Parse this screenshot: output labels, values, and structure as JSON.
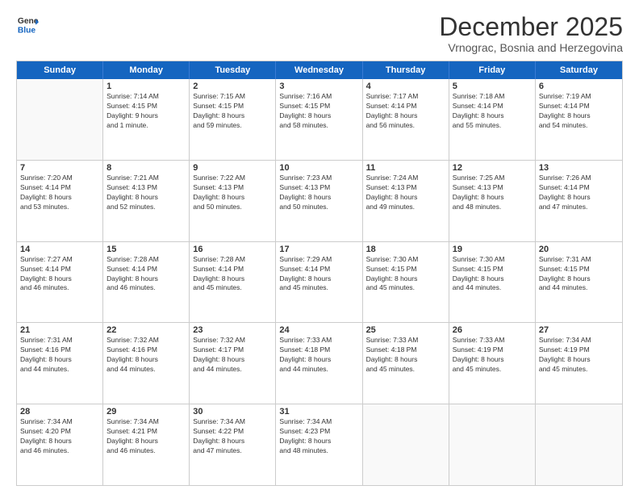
{
  "logo": {
    "line1": "General",
    "line2": "Blue"
  },
  "title": "December 2025",
  "subtitle": "Vrnograc, Bosnia and Herzegovina",
  "days": [
    "Sunday",
    "Monday",
    "Tuesday",
    "Wednesday",
    "Thursday",
    "Friday",
    "Saturday"
  ],
  "weeks": [
    [
      {
        "day": "",
        "text": ""
      },
      {
        "day": "1",
        "text": "Sunrise: 7:14 AM\nSunset: 4:15 PM\nDaylight: 9 hours\nand 1 minute."
      },
      {
        "day": "2",
        "text": "Sunrise: 7:15 AM\nSunset: 4:15 PM\nDaylight: 8 hours\nand 59 minutes."
      },
      {
        "day": "3",
        "text": "Sunrise: 7:16 AM\nSunset: 4:15 PM\nDaylight: 8 hours\nand 58 minutes."
      },
      {
        "day": "4",
        "text": "Sunrise: 7:17 AM\nSunset: 4:14 PM\nDaylight: 8 hours\nand 56 minutes."
      },
      {
        "day": "5",
        "text": "Sunrise: 7:18 AM\nSunset: 4:14 PM\nDaylight: 8 hours\nand 55 minutes."
      },
      {
        "day": "6",
        "text": "Sunrise: 7:19 AM\nSunset: 4:14 PM\nDaylight: 8 hours\nand 54 minutes."
      }
    ],
    [
      {
        "day": "7",
        "text": "Sunrise: 7:20 AM\nSunset: 4:14 PM\nDaylight: 8 hours\nand 53 minutes."
      },
      {
        "day": "8",
        "text": "Sunrise: 7:21 AM\nSunset: 4:13 PM\nDaylight: 8 hours\nand 52 minutes."
      },
      {
        "day": "9",
        "text": "Sunrise: 7:22 AM\nSunset: 4:13 PM\nDaylight: 8 hours\nand 50 minutes."
      },
      {
        "day": "10",
        "text": "Sunrise: 7:23 AM\nSunset: 4:13 PM\nDaylight: 8 hours\nand 50 minutes."
      },
      {
        "day": "11",
        "text": "Sunrise: 7:24 AM\nSunset: 4:13 PM\nDaylight: 8 hours\nand 49 minutes."
      },
      {
        "day": "12",
        "text": "Sunrise: 7:25 AM\nSunset: 4:13 PM\nDaylight: 8 hours\nand 48 minutes."
      },
      {
        "day": "13",
        "text": "Sunrise: 7:26 AM\nSunset: 4:14 PM\nDaylight: 8 hours\nand 47 minutes."
      }
    ],
    [
      {
        "day": "14",
        "text": "Sunrise: 7:27 AM\nSunset: 4:14 PM\nDaylight: 8 hours\nand 46 minutes."
      },
      {
        "day": "15",
        "text": "Sunrise: 7:28 AM\nSunset: 4:14 PM\nDaylight: 8 hours\nand 46 minutes."
      },
      {
        "day": "16",
        "text": "Sunrise: 7:28 AM\nSunset: 4:14 PM\nDaylight: 8 hours\nand 45 minutes."
      },
      {
        "day": "17",
        "text": "Sunrise: 7:29 AM\nSunset: 4:14 PM\nDaylight: 8 hours\nand 45 minutes."
      },
      {
        "day": "18",
        "text": "Sunrise: 7:30 AM\nSunset: 4:15 PM\nDaylight: 8 hours\nand 45 minutes."
      },
      {
        "day": "19",
        "text": "Sunrise: 7:30 AM\nSunset: 4:15 PM\nDaylight: 8 hours\nand 44 minutes."
      },
      {
        "day": "20",
        "text": "Sunrise: 7:31 AM\nSunset: 4:15 PM\nDaylight: 8 hours\nand 44 minutes."
      }
    ],
    [
      {
        "day": "21",
        "text": "Sunrise: 7:31 AM\nSunset: 4:16 PM\nDaylight: 8 hours\nand 44 minutes."
      },
      {
        "day": "22",
        "text": "Sunrise: 7:32 AM\nSunset: 4:16 PM\nDaylight: 8 hours\nand 44 minutes."
      },
      {
        "day": "23",
        "text": "Sunrise: 7:32 AM\nSunset: 4:17 PM\nDaylight: 8 hours\nand 44 minutes."
      },
      {
        "day": "24",
        "text": "Sunrise: 7:33 AM\nSunset: 4:18 PM\nDaylight: 8 hours\nand 44 minutes."
      },
      {
        "day": "25",
        "text": "Sunrise: 7:33 AM\nSunset: 4:18 PM\nDaylight: 8 hours\nand 45 minutes."
      },
      {
        "day": "26",
        "text": "Sunrise: 7:33 AM\nSunset: 4:19 PM\nDaylight: 8 hours\nand 45 minutes."
      },
      {
        "day": "27",
        "text": "Sunrise: 7:34 AM\nSunset: 4:19 PM\nDaylight: 8 hours\nand 45 minutes."
      }
    ],
    [
      {
        "day": "28",
        "text": "Sunrise: 7:34 AM\nSunset: 4:20 PM\nDaylight: 8 hours\nand 46 minutes."
      },
      {
        "day": "29",
        "text": "Sunrise: 7:34 AM\nSunset: 4:21 PM\nDaylight: 8 hours\nand 46 minutes."
      },
      {
        "day": "30",
        "text": "Sunrise: 7:34 AM\nSunset: 4:22 PM\nDaylight: 8 hours\nand 47 minutes."
      },
      {
        "day": "31",
        "text": "Sunrise: 7:34 AM\nSunset: 4:23 PM\nDaylight: 8 hours\nand 48 minutes."
      },
      {
        "day": "",
        "text": ""
      },
      {
        "day": "",
        "text": ""
      },
      {
        "day": "",
        "text": ""
      }
    ]
  ]
}
